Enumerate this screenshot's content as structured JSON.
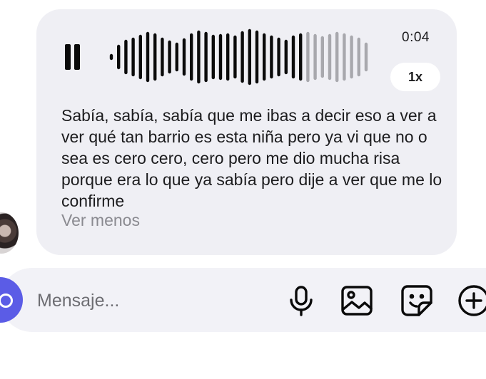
{
  "voice_message": {
    "duration": "0:04",
    "speed": "1x",
    "progress": 0.74,
    "transcript": "Sabía, sabía, sabía que me ibas a decir eso a ver a ver qué tan barrio es esta niña pero ya vi que no o sea es cero cero, cero pero me dio mucha risa porque era lo que ya sabía pero dije a ver que me lo confirme",
    "show_less_label": "Ver menos",
    "play_state_icon": "pause-icon"
  },
  "composer": {
    "placeholder": "Mensaje...",
    "icons": [
      "camera-icon",
      "microphone-icon",
      "image-gallery-icon",
      "sticker-icon",
      "plus-icon"
    ]
  },
  "colors": {
    "bubble_bg": "#efeff4",
    "waveform_played": "#0a0a0a",
    "waveform_unplayed": "#a8a8ad",
    "camera_button": "#5b5ce6",
    "secondary_text": "#8a8a90"
  }
}
